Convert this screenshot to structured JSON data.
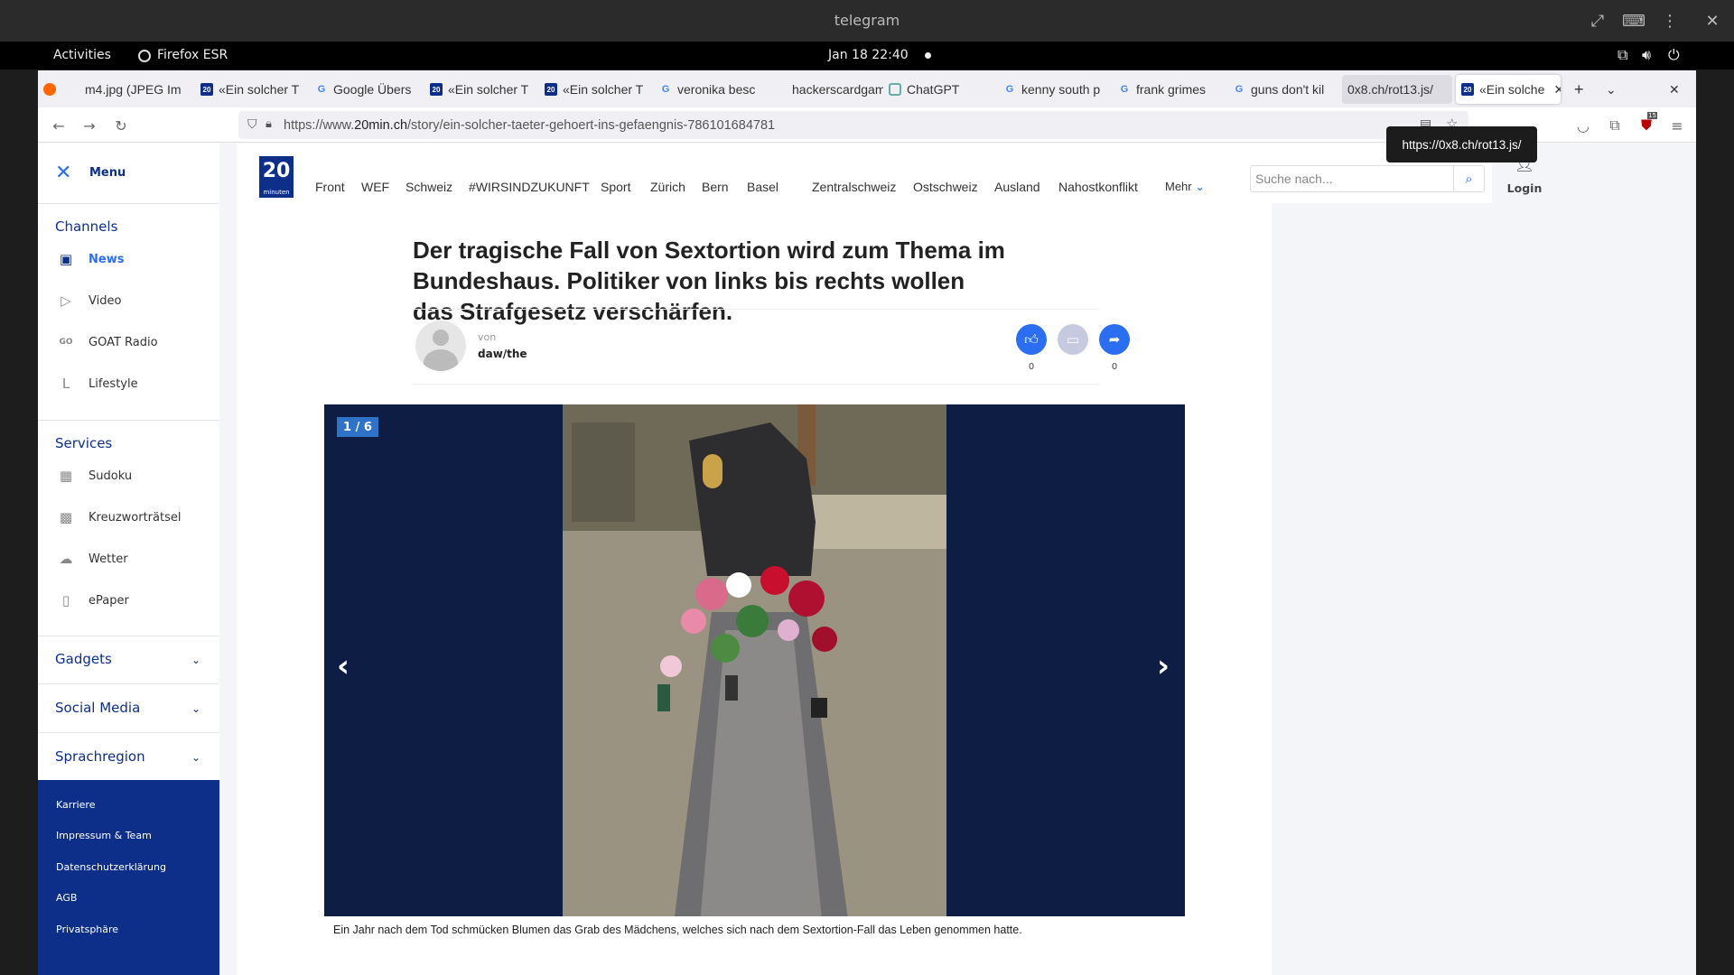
{
  "window": {
    "title": "telegram"
  },
  "gnome": {
    "activities": "Activities",
    "app": "Firefox ESR",
    "clock": "Jan 18  22:40"
  },
  "tabs": [
    {
      "label": "m4.jpg (JPEG Im",
      "icon": "firefox-icon"
    },
    {
      "label": "«Ein solcher T",
      "icon": "20min-icon"
    },
    {
      "label": "Google Übers",
      "icon": "translate-icon"
    },
    {
      "label": "«Ein solcher T",
      "icon": "20min-icon"
    },
    {
      "label": "«Ein solcher T",
      "icon": "20min-icon"
    },
    {
      "label": "veronika besc",
      "icon": "google-icon"
    },
    {
      "label": "hackerscardgam",
      "icon": "none"
    },
    {
      "label": "ChatGPT",
      "icon": "chatgpt-icon"
    },
    {
      "label": "kenny south p",
      "icon": "google-icon"
    },
    {
      "label": "frank grimes",
      "icon": "google-icon"
    },
    {
      "label": "guns don't kil",
      "icon": "google-icon"
    },
    {
      "label": "0x8.ch/rot13.js/",
      "icon": "none"
    },
    {
      "label": "«Ein solche",
      "icon": "20min-icon"
    }
  ],
  "url": {
    "prefix": "https://www.",
    "domain": "20min.ch",
    "path": "/story/ein-solcher-taeter-gehoert-ins-gefaengnis-786101684781"
  },
  "tooltip": "https://0x8.ch/rot13.js/",
  "extension_badge": "15",
  "sidebar": {
    "menu": "Menu",
    "channels": "Channels",
    "channel_items": [
      "News",
      "Video",
      "GOAT Radio",
      "Lifestyle"
    ],
    "services": "Services",
    "service_items": [
      "Sudoku",
      "Kreuzworträtsel",
      "Wetter",
      "ePaper"
    ],
    "collapsibles": [
      "Gadgets",
      "Social Media",
      "Sprachregion"
    ],
    "footer_links": [
      "Karriere",
      "Impressum & Team",
      "Datenschutzerklärung",
      "AGB",
      "Privatsphäre"
    ]
  },
  "topnav": {
    "logo": "20",
    "logo_sub": "minuten",
    "items": [
      "Front",
      "WEF",
      "Schweiz",
      "#WIRSINDZUKUNFT",
      "Sport",
      "Zürich",
      "Bern",
      "Basel",
      "Zentralschweiz",
      "Ostschweiz",
      "Ausland",
      "Nahostkonflikt"
    ],
    "more": "Mehr",
    "search_placeholder": "Suche nach...",
    "login": "Login"
  },
  "article": {
    "headline": "Der tragische Fall von Sextortion wird zum Thema im Bundeshaus. Politiker von links bis rechts wollen das Strafgesetz verschärfen.",
    "by_label": "von",
    "author": "daw/the",
    "like_count": "0",
    "share_count": "0"
  },
  "gallery": {
    "counter": "1 / 6",
    "caption": "Ein Jahr nach dem Tod schmücken Blumen das Grab des Mädchens, welches sich nach dem Sextortion-Fall das Leben genommen hatte."
  }
}
